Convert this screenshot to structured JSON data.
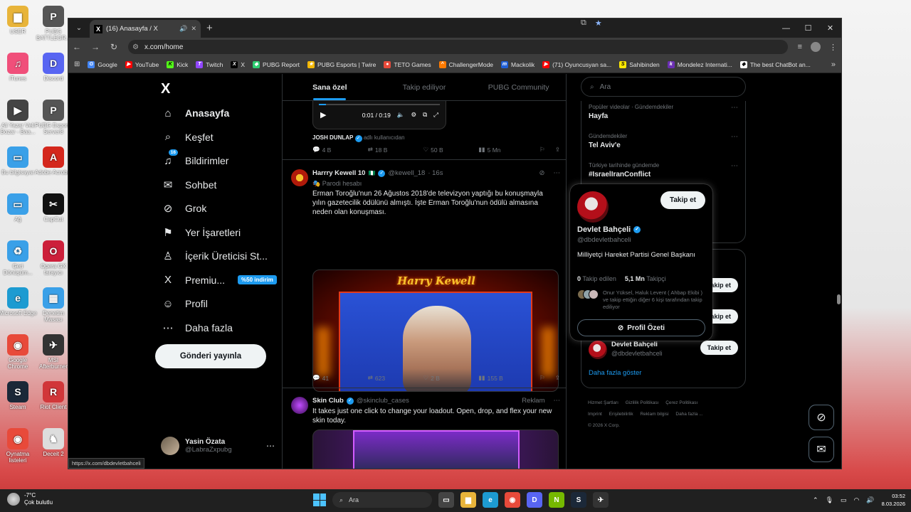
{
  "desktop": {
    "icons_left": [
      {
        "label": "USER",
        "color": "#e8b43a",
        "glyph": "▆"
      },
      {
        "label": "iTunes",
        "color": "#f04f7a",
        "glyph": "♫"
      },
      {
        "label": "Ali Yazar Veli Bozar - Baa...",
        "color": "#444444",
        "glyph": "▶"
      },
      {
        "label": "Bu bilgisayar",
        "color": "#3aa0e8",
        "glyph": "▭"
      },
      {
        "label": "Ağ",
        "color": "#3aa0e8",
        "glyph": "▭"
      },
      {
        "label": "Geri Dönüşüm...",
        "color": "#3aa0e8",
        "glyph": "♻"
      },
      {
        "label": "Microsoft Edge",
        "color": "#1d9bd1",
        "glyph": "e"
      },
      {
        "label": "Google Chrome",
        "color": "#e84a3a",
        "glyph": "◉"
      },
      {
        "label": "Steam",
        "color": "#1b2838",
        "glyph": "S"
      },
      {
        "label": "Oynatma listeleri",
        "color": "#e84a3a",
        "glyph": "◉"
      }
    ],
    "icons_col2": [
      {
        "label": "PUBG BATTLEGR...",
        "color": "#555555",
        "glyph": "P"
      },
      {
        "label": "Discord",
        "color": "#5865f2",
        "glyph": "D"
      },
      {
        "label": "PUBG Esports Server8",
        "color": "#555555",
        "glyph": "P"
      },
      {
        "label": "Adobe Acrobat",
        "color": "#d4271c",
        "glyph": "A"
      },
      {
        "label": "CapCut",
        "color": "#111111",
        "glyph": "✂"
      },
      {
        "label": "Opera GX tarayıcı",
        "color": "#cc1f3a",
        "glyph": "O"
      },
      {
        "label": "Denetim Masası",
        "color": "#3aa0e8",
        "glyph": "▦"
      },
      {
        "label": "MSI Afterburner",
        "color": "#333333",
        "glyph": "✈"
      },
      {
        "label": "Riot Client",
        "color": "#d13639",
        "glyph": "R"
      },
      {
        "label": "Deceit 2",
        "color": "#dddddd",
        "glyph": "♞"
      }
    ]
  },
  "browser": {
    "tab_title": "(16) Anasayfa / X",
    "url": "x.com/home",
    "status_url": "https://x.com/dbdevletbahceli",
    "bookmarks": [
      {
        "label": "Google",
        "color": "#4285f4",
        "glyph": "G"
      },
      {
        "label": "YouTube",
        "color": "#ff0000",
        "glyph": "▶"
      },
      {
        "label": "Kick",
        "color": "#53fc18",
        "glyph": "K"
      },
      {
        "label": "Twitch",
        "color": "#9146ff",
        "glyph": "T"
      },
      {
        "label": "X",
        "color": "#000000",
        "glyph": "X"
      },
      {
        "label": "PUBG Report",
        "color": "#2ecc71",
        "glyph": "◆"
      },
      {
        "label": "PUBG Esports | Twire",
        "color": "#f2b705",
        "glyph": "★"
      },
      {
        "label": "TETO Games",
        "color": "#e84a3a",
        "glyph": "●"
      },
      {
        "label": "ChallengerMode",
        "color": "#ff7a00",
        "glyph": "^"
      },
      {
        "label": "Mackolik",
        "color": "#1f5fd6",
        "glyph": "m"
      },
      {
        "label": "(71) Oyuncusyan sa...",
        "color": "#ff0000",
        "glyph": "▶"
      },
      {
        "label": "Sahibinden",
        "color": "#ffe800",
        "glyph": "S"
      },
      {
        "label": "Mondelez Internati...",
        "color": "#6b2fb3",
        "glyph": "k"
      },
      {
        "label": "The best ChatBot an...",
        "color": "#ffffff",
        "glyph": "◆"
      }
    ]
  },
  "sidebar": {
    "items": [
      {
        "label": "Anasayfa",
        "icon": "⌂"
      },
      {
        "label": "Keşfet",
        "icon": "⌕"
      },
      {
        "label": "Bildirimler",
        "icon": "♫",
        "badge": "16"
      },
      {
        "label": "Sohbet",
        "icon": "✉"
      },
      {
        "label": "Grok",
        "icon": "⊘"
      },
      {
        "label": "Yer İşaretleri",
        "icon": "⚑"
      },
      {
        "label": "İçerik Üreticisi St...",
        "icon": "♙"
      },
      {
        "label": "Premiu...",
        "icon": "X",
        "promo": "%50 indirim"
      },
      {
        "label": "Profil",
        "icon": "☺"
      },
      {
        "label": "Daha fazla",
        "icon": "⋯"
      }
    ],
    "post_button": "Gönderi yayınla",
    "user": {
      "name": "Yasin Özata",
      "handle": "@LabraZxpubg"
    }
  },
  "feed": {
    "tabs": [
      "Sana özel",
      "Takip ediliyor",
      "PUBG Community"
    ],
    "video_time": "0:01 / 0:19",
    "credit_name": "JOSH DUNLAP",
    "credit_suffix": "adlı kullanıcıdan",
    "post0_actions": {
      "replies": "4 B",
      "reposts": "18 B",
      "likes": "50 B",
      "views": "5 Mn"
    },
    "post1": {
      "name": "Harrry Kewell 10",
      "handle": "@kewell_18",
      "time": "· 16s",
      "label": "Parodi hesabı",
      "text": "Erman Toroğlu'nun 26 Ağustos 2018'de televizyon  yaptığı bu konuşmayla yılın gazetecilik ödülünü almıştı. İşte Erman Toroğlu'nun ödülü almasına neden olan konuşması.",
      "banner": "Harry Kewell",
      "actions": {
        "replies": "41",
        "reposts": "623",
        "likes": "2 B",
        "views": "155 B"
      }
    },
    "post2": {
      "name": "Skin Club",
      "handle": "@skinclub_cases",
      "ad_label": "Reklam",
      "text": "It takes just one click to change your loadout. Open, drop, and flex your new skin today."
    }
  },
  "right": {
    "search_placeholder": "Ara",
    "trends": [
      {
        "meta": "Popüler videolar · Gündemdekiler",
        "name": "Hayfa"
      },
      {
        "meta": "Gündemdekiler",
        "name": "Tel Aviv'e"
      },
      {
        "meta": "Türkiye tarihinde gündemde",
        "name": "#IsraelIranConflict"
      }
    ],
    "follow_label": "Takip et",
    "wf_name": "Devlet Bahçeli",
    "wf_handle": "@dbdevletbahceli",
    "show_more": "Daha fazla göster",
    "footer": [
      "Hizmet Şartları",
      "Gizlilik Politikası",
      "Çerez Politikası",
      "Imprint",
      "Erişilebilirlik",
      "Reklam bilgisi",
      "Daha fazla ...",
      "© 2026 X Corp."
    ]
  },
  "hovercard": {
    "follow": "Takip et",
    "name": "Devlet Bahçeli",
    "handle": "@dbdevletbahceli",
    "bio": "Milliyetçi Hareket Partisi Genel Başkanı",
    "following_count": "0",
    "following_label": "Takip edilen",
    "followers_count": "5,1 Mn",
    "followers_label": "Takipçi",
    "mutual": "Onur Yüksel, Haluk Levent ( Ahbap Ekibi ) ve takip ettiğin diğer 6 kişi tarafından takip ediliyor",
    "summary": "Profil Özeti"
  },
  "taskbar": {
    "temp": "-7°C",
    "weather": "Çok bulutlu",
    "search": "Ara",
    "time": "03:52",
    "date": "8.03.2026",
    "apps": [
      {
        "glyph": "▭",
        "color": "#444444"
      },
      {
        "glyph": "▆",
        "color": "#e8b43a"
      },
      {
        "glyph": "e",
        "color": "#1d9bd1"
      },
      {
        "glyph": "◉",
        "color": "#e84a3a"
      },
      {
        "glyph": "D",
        "color": "#5865f2"
      },
      {
        "glyph": "N",
        "color": "#76b900"
      },
      {
        "glyph": "S",
        "color": "#1b2838"
      },
      {
        "glyph": "✈",
        "color": "#333333"
      }
    ]
  }
}
